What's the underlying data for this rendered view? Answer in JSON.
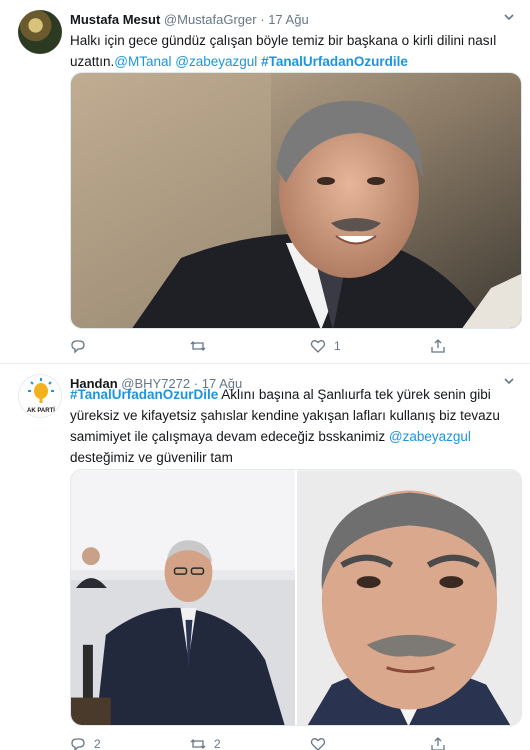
{
  "tweets": [
    {
      "name": "Mustafa Mesut",
      "handle": "@MustafaGrger",
      "separator": "·",
      "date": "17 Ağu",
      "text_plain_1": "Halkı için gece gündüz çalışan böyle temiz bir başkana o kirli dilini nasıl uzattın.",
      "mention_1": "@MTanal",
      "mention_2": "@zabeyazgul",
      "hashtag": "#TanalUrfadanOzurdile",
      "reply_count": "",
      "retweet_count": "",
      "like_count": "1"
    },
    {
      "name": "Handan",
      "handle": "@BHY7272",
      "separator": "·",
      "date": "17 Ağu",
      "hashtag": "#TanalUrfadanOzurDile",
      "text_plain_1": " Aklını başına al Şanlıurfa tek yürek senin gibi yüreksiz ve kifayetsiz şahıslar kendine yakışan lafları kullanış biz tevazu samimiyet ile çalışmaya devam edeceğiz bsskanimiz ",
      "mention_1": "@zabeyazgul",
      "text_plain_2": " desteğimiz ve güvenilir tam",
      "avatar_label": "AK PARTİ",
      "reply_count": "2",
      "retweet_count": "2",
      "like_count": ""
    }
  ],
  "icons": {
    "reply": "reply-icon",
    "retweet": "retweet-icon",
    "like": "heart-icon",
    "share": "share-icon",
    "more": "chevron-down-icon"
  },
  "colors": {
    "link": "#1b95e0",
    "muted": "#657786",
    "divider": "#e6ecf0"
  }
}
